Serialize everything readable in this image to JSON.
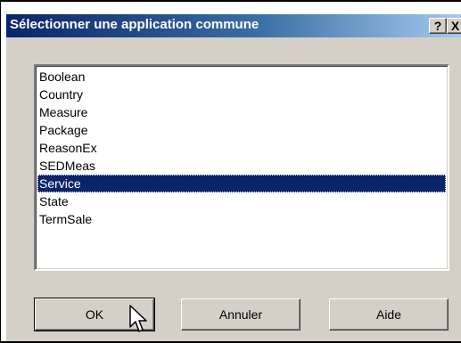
{
  "dialog": {
    "title": "Sélectionner une application commune",
    "help_glyph": "?",
    "close_glyph": "X"
  },
  "list": {
    "items": [
      "Boolean",
      "Country",
      "Measure",
      "Package",
      "ReasonEx",
      "SEDMeas",
      "Service",
      "State",
      "TermSale"
    ],
    "selected": "Service"
  },
  "buttons": {
    "ok": "OK",
    "cancel": "Annuler",
    "help": "Aide"
  },
  "colors": {
    "title_bar": "#0a246a",
    "selection": "#0a246a",
    "face": "#d4d0c8"
  }
}
